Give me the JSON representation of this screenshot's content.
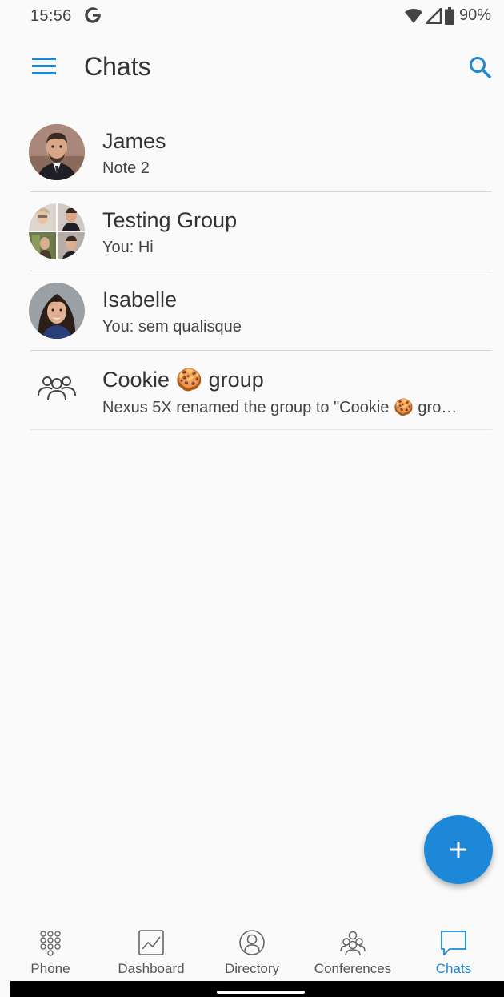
{
  "status_bar": {
    "time": "15:56",
    "battery": "90%",
    "icons": [
      "google-g-icon",
      "wifi-icon",
      "signal-icon",
      "battery-icon"
    ]
  },
  "app_bar": {
    "title": "Chats",
    "icons": [
      "menu-icon",
      "search-icon"
    ]
  },
  "chats": [
    {
      "name": "James",
      "preview": "Note 2",
      "avatar": "photo"
    },
    {
      "name": "Testing Group",
      "preview": "You: Hi",
      "avatar": "group-photo"
    },
    {
      "name": "Isabelle",
      "preview": "You: sem qualisque",
      "avatar": "photo"
    },
    {
      "name": "Cookie 🍪 group",
      "preview": "Nexus 5X renamed the group to \"Cookie 🍪 gro…",
      "avatar": "group-icon"
    }
  ],
  "fab": {
    "icon": "plus-icon"
  },
  "bottom_nav": {
    "items": [
      {
        "label": "Phone",
        "icon": "dialpad-icon"
      },
      {
        "label": "Dashboard",
        "icon": "chart-icon"
      },
      {
        "label": "Directory",
        "icon": "person-icon"
      },
      {
        "label": "Conferences",
        "icon": "conference-icon"
      },
      {
        "label": "Chats",
        "icon": "chat-bubble-icon"
      }
    ],
    "active": "Chats"
  },
  "colors": {
    "accent": "#1e88d8",
    "background": "#fafafa",
    "text": "#333333",
    "divider": "#d5d5d5"
  }
}
